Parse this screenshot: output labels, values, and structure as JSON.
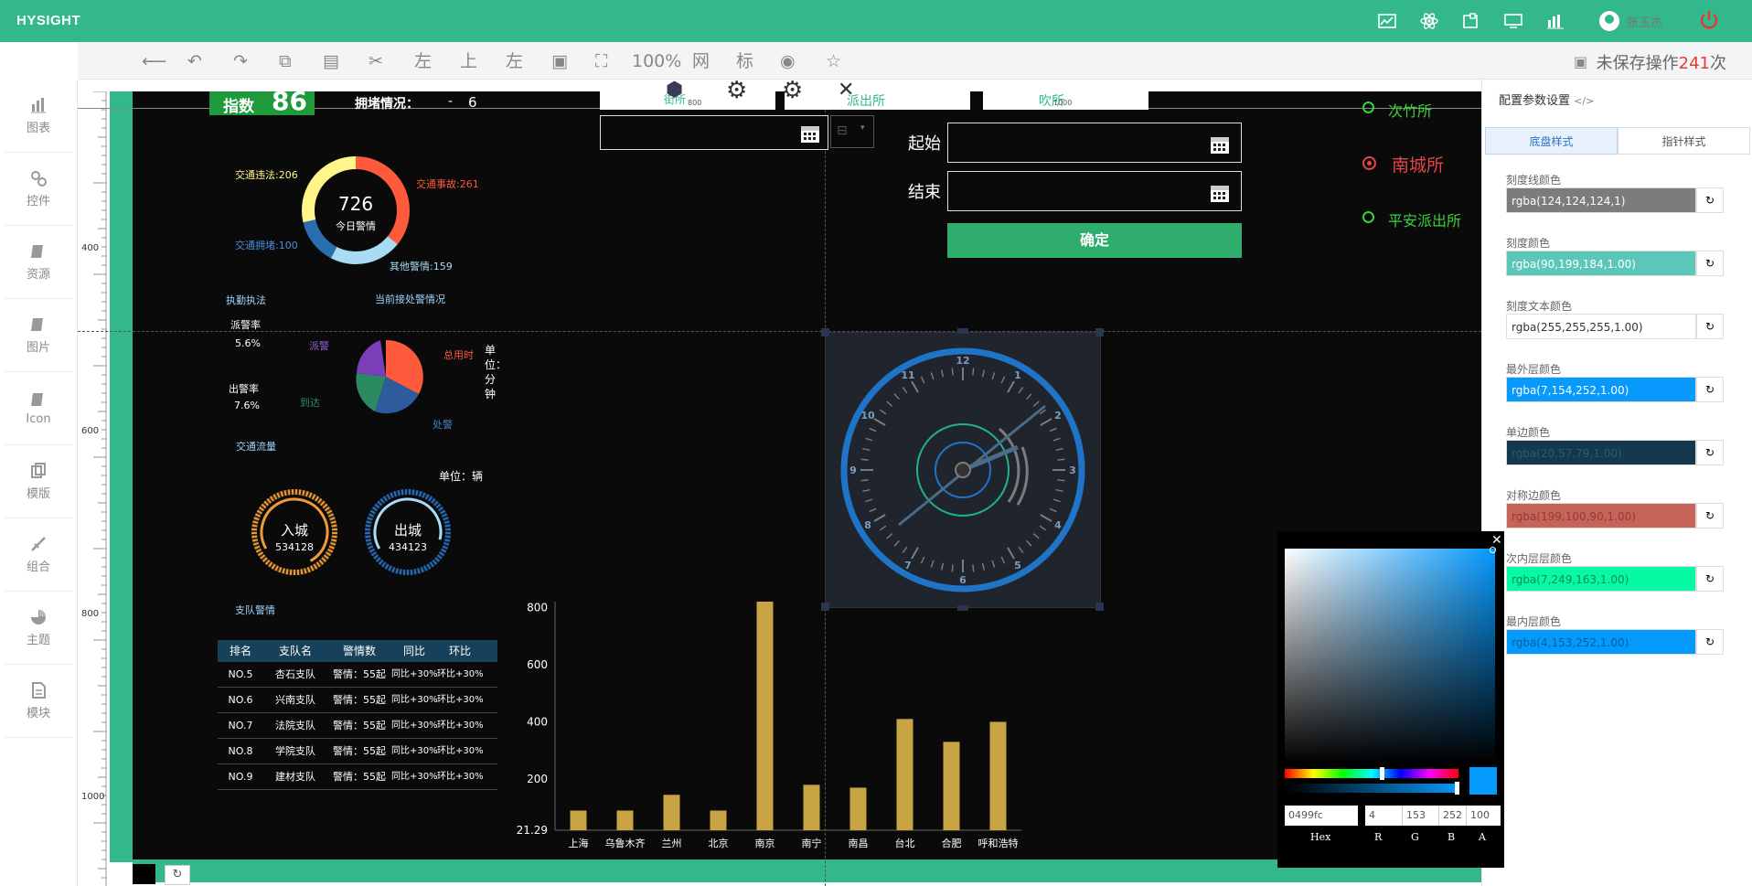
{
  "app": {
    "logo": "HYSIGHT",
    "user": "张玉杰"
  },
  "toolbar": {
    "zoom": "100%",
    "grid": "网",
    "mark": "标",
    "left1": "左",
    "up": "上",
    "left2": "左",
    "unsaved_label": "未保存操作",
    "unsaved_count": "241",
    "unsaved_suffix": "次"
  },
  "sidebar": {
    "items": [
      {
        "label": "图表",
        "icon": "chart-icon"
      },
      {
        "label": "控件",
        "icon": "widget-icon"
      },
      {
        "label": "资源",
        "icon": "book-icon"
      },
      {
        "label": "图片",
        "icon": "image-book-icon"
      },
      {
        "label": "Icon",
        "icon": "icon-book-icon"
      },
      {
        "label": "模版",
        "icon": "template-icon"
      },
      {
        "label": "组合",
        "icon": "combine-icon"
      },
      {
        "label": "主题",
        "icon": "theme-icon"
      },
      {
        "label": "模块",
        "icon": "module-icon"
      }
    ]
  },
  "ruler": {
    "top": [
      "800",
      "1000"
    ],
    "left": [
      "400",
      "600",
      "800",
      "1000"
    ]
  },
  "canvas": {
    "index_label": "指数",
    "index_value": "86",
    "congestion_label": "拥堵情况：",
    "congestion_dash": "-",
    "congestion_value": "6",
    "donut": {
      "center_value": "726",
      "center_label": "今日警情",
      "l1": "交通违法:206",
      "l2": "交通事故:261",
      "l3": "交通拥堵:100",
      "l4": "其他警情:159"
    },
    "law_title": "执勤执法",
    "handling_title": "当前接处警情况",
    "dispatch_label": "派警率",
    "dispatch_value": "5.6%",
    "out_label": "出警率",
    "out_value": "7.6%",
    "pie": {
      "l1": "派警",
      "l2": "总用时",
      "l3": "到达",
      "l4": "处警",
      "unit": "单位：分钟"
    },
    "traffic_title": "交通流量",
    "traffic_unit": "单位：辆",
    "in_label": "入城",
    "in_value": "534128",
    "out_city_label": "出城",
    "out_city_value": "434123",
    "team_title": "支队警情",
    "table": {
      "headers": [
        "排名",
        "支队名",
        "警情数",
        "同比",
        "环比"
      ],
      "rows": [
        [
          "NO.5",
          "杏石支队",
          "警情：55起",
          "同比+30%",
          "环比+30%"
        ],
        [
          "NO.6",
          "兴南支队",
          "警情：55起",
          "同比+30%",
          "环比+30%"
        ],
        [
          "NO.7",
          "法院支队",
          "警情：55起",
          "同比+30%",
          "环比+30%"
        ],
        [
          "NO.8",
          "学院支队",
          "警情：55起",
          "同比+30%",
          "环比+30%"
        ],
        [
          "NO.9",
          "建材支队",
          "警情：55起",
          "同比+30%",
          "环比+30%"
        ]
      ]
    },
    "start_label": "起始",
    "end_label": "结束",
    "confirm": "确定",
    "radios": [
      {
        "label": "次竹所",
        "color": "#3bd13b",
        "checked": false
      },
      {
        "label": "南城所",
        "color": "#e54545",
        "checked": true
      },
      {
        "label": "平安派出所",
        "color": "#3bd13b",
        "checked": false
      }
    ],
    "tabs_partial": [
      "街所",
      "派出所",
      "吹所"
    ],
    "clock_numbers": [
      "12",
      "1",
      "2",
      "3",
      "4",
      "5",
      "6",
      "7",
      "8",
      "9",
      "10",
      "11"
    ]
  },
  "chart_data": {
    "type": "bar",
    "categories": [
      "上海",
      "乌鲁木齐",
      "兰州",
      "北京",
      "南京",
      "南宁",
      "南昌",
      "台北",
      "合肥",
      "呼和浩特"
    ],
    "values": [
      90,
      90,
      145,
      90,
      820,
      180,
      170,
      410,
      330,
      400
    ],
    "yticks": [
      "800",
      "600",
      "400",
      "200",
      "21.29"
    ],
    "ylim": [
      21.29,
      820
    ],
    "color": "#c9a444"
  },
  "panel": {
    "title": "配置参数设置",
    "tabs": [
      "底盘样式",
      "指针样式"
    ],
    "props": [
      {
        "label": "刻度线颜色",
        "value": "rgba(124,124,124,1)",
        "color": "#7c7c7c",
        "text": "#fff"
      },
      {
        "label": "刻度颜色",
        "value": "rgba(90,199,184,1.00)",
        "color": "#5ac7b8",
        "text": "#fff"
      },
      {
        "label": "刻度文本颜色",
        "value": "rgba(255,255,255,1.00)",
        "color": "#ffffff",
        "text": "#333"
      },
      {
        "label": "最外层颜色",
        "value": "rgba(7,154,252,1.00)",
        "color": "#079afc",
        "text": "#fff"
      },
      {
        "label": "单边颜色",
        "value": "rgba(20,57,79,1.00)",
        "color": "#14394f",
        "text": "#2a5a78"
      },
      {
        "label": "对称边颜色",
        "value": "rgba(199,100,90,1.00)",
        "color": "#c7645a",
        "text": "#8e3c35"
      },
      {
        "label": "次内层层颜色",
        "value": "rgba(7,249,163,1.00)",
        "color": "#07f9a3",
        "text": "#0a8a5e"
      },
      {
        "label": "最内层颜色",
        "value": "rgba(4,153,252,1.00)",
        "color": "#0499fc",
        "text": "#0a5d9a"
      }
    ]
  },
  "picker": {
    "hex": "0499fc",
    "r": "4",
    "g": "153",
    "b": "252",
    "a": "100",
    "hex_label": "Hex",
    "r_label": "R",
    "g_label": "G",
    "b_label": "B",
    "a_label": "A",
    "swatch": "#0499fc"
  }
}
